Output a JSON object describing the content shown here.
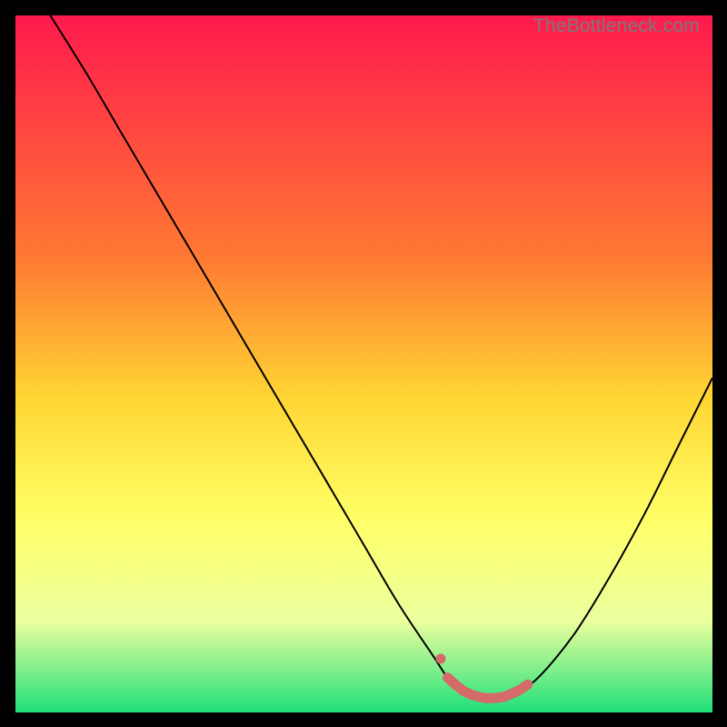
{
  "watermark": "TheBottleneck.com",
  "colors": {
    "bg": "#000000",
    "curve": "#000000",
    "marker": "#d46a6a",
    "grad_top": "#ff1a4d",
    "grad_mid1": "#ff7a33",
    "grad_mid2": "#ffd633",
    "grad_mid3": "#ffff66",
    "grad_mid4": "#eaff9e",
    "grad_bottom": "#1fe07a"
  },
  "chart_data": {
    "type": "line",
    "title": "",
    "xlabel": "",
    "ylabel": "",
    "xlim": [
      0,
      100
    ],
    "ylim": [
      0,
      100
    ],
    "series": [
      {
        "name": "bottleneck-curve",
        "x": [
          5,
          10,
          15,
          20,
          25,
          30,
          35,
          40,
          45,
          50,
          55,
          60,
          62,
          64,
          66,
          68,
          70,
          72,
          75,
          80,
          85,
          90,
          95,
          100
        ],
        "y": [
          100,
          92,
          83.5,
          75,
          66.5,
          58,
          49.5,
          41,
          32.5,
          24,
          15.5,
          8,
          5,
          3.2,
          2.3,
          2,
          2.2,
          3,
          5,
          11,
          19,
          28,
          38,
          48
        ]
      }
    ],
    "markers": [
      {
        "name": "optimal-band",
        "x_range": [
          61,
          73.5
        ],
        "y": 2.5
      }
    ],
    "gradient_stops": [
      {
        "pos": 0,
        "color": "#ff1a4d"
      },
      {
        "pos": 35,
        "color": "#ff7a33"
      },
      {
        "pos": 55,
        "color": "#ffd633"
      },
      {
        "pos": 72,
        "color": "#ffff66"
      },
      {
        "pos": 87,
        "color": "#eaff9e"
      },
      {
        "pos": 100,
        "color": "#1fe07a"
      }
    ]
  }
}
